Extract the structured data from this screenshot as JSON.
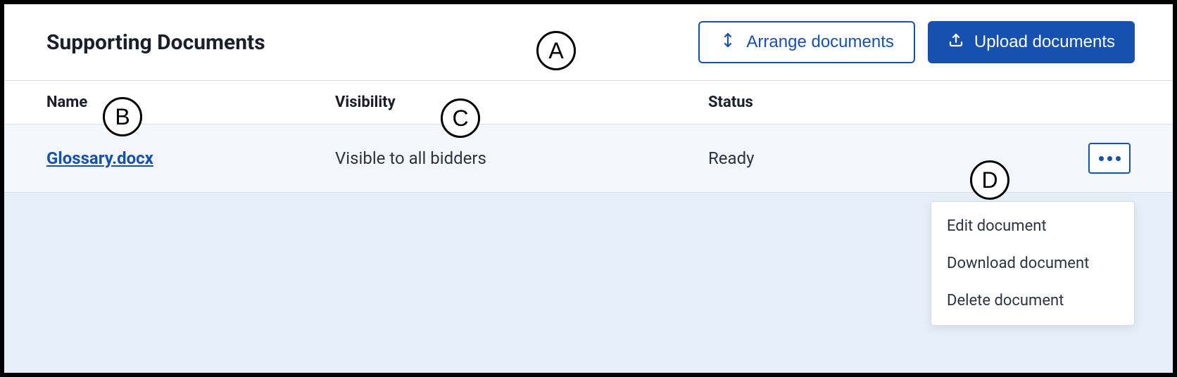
{
  "header": {
    "title": "Supporting Documents",
    "arrange_label": "Arrange documents",
    "upload_label": "Upload documents"
  },
  "columns": {
    "name": "Name",
    "visibility": "Visibility",
    "status": "Status"
  },
  "rows": [
    {
      "name": "Glossary.docx",
      "visibility": "Visible to all bidders",
      "status": "Ready"
    }
  ],
  "menu": {
    "edit": "Edit document",
    "download": "Download document",
    "delete": "Delete document"
  },
  "callouts": {
    "a": "A",
    "b": "B",
    "c": "C",
    "d": "D"
  }
}
